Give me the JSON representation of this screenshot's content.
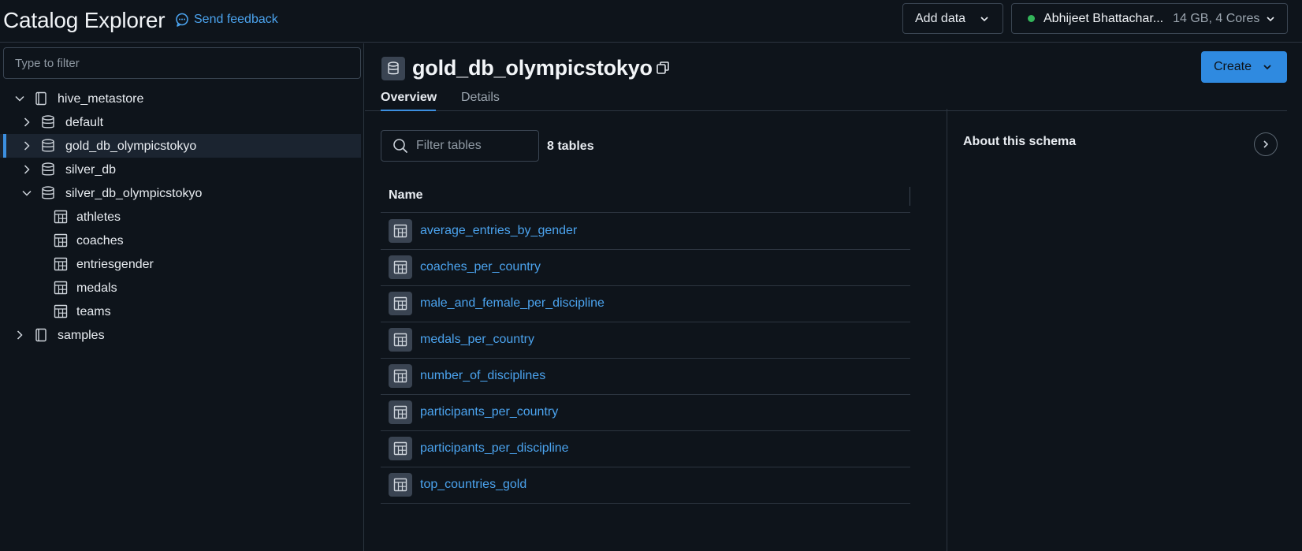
{
  "header": {
    "title": "Catalog Explorer",
    "feedback_label": "Send feedback",
    "add_data_label": "Add data",
    "cluster_name": "Abhijeet Bhattachar...",
    "cluster_size": "14 GB, 4 Cores",
    "cluster_status_color": "#33b55a"
  },
  "sidebar": {
    "filter_placeholder": "Type to filter",
    "tree": [
      {
        "label": "hive_metastore",
        "icon": "catalog-icon",
        "expanded": true,
        "level": 0
      },
      {
        "label": "default",
        "icon": "database-icon",
        "expanded": false,
        "level": 1
      },
      {
        "label": "gold_db_olympicstokyo",
        "icon": "database-icon",
        "expanded": false,
        "level": 1,
        "selected": true
      },
      {
        "label": "silver_db",
        "icon": "database-icon",
        "expanded": false,
        "level": 1
      },
      {
        "label": "silver_db_olympicstokyo",
        "icon": "database-icon",
        "expanded": true,
        "level": 1
      },
      {
        "label": "athletes",
        "icon": "table-icon",
        "level": 2
      },
      {
        "label": "coaches",
        "icon": "table-icon",
        "level": 2
      },
      {
        "label": "entriesgender",
        "icon": "table-icon",
        "level": 2
      },
      {
        "label": "medals",
        "icon": "table-icon",
        "level": 2
      },
      {
        "label": "teams",
        "icon": "table-icon",
        "level": 2
      },
      {
        "label": "samples",
        "icon": "catalog-icon",
        "expanded": false,
        "level": 0
      }
    ]
  },
  "main": {
    "schema_name": "gold_db_olympicstokyo",
    "create_label": "Create",
    "tabs": [
      {
        "label": "Overview",
        "active": true
      },
      {
        "label": "Details",
        "active": false
      }
    ],
    "filter_placeholder": "Filter tables",
    "table_count": "8 tables",
    "column_name": "Name",
    "tables": [
      "average_entries_by_gender",
      "coaches_per_country",
      "male_and_female_per_discipline",
      "medals_per_country",
      "number_of_disciplines",
      "participants_per_country",
      "participants_per_discipline",
      "top_countries_gold"
    ],
    "about_title": "About this schema"
  },
  "colors": {
    "background": "#0e141b",
    "accent": "#2f8ae0",
    "link": "#4ba3ee",
    "border": "#2c3540"
  }
}
